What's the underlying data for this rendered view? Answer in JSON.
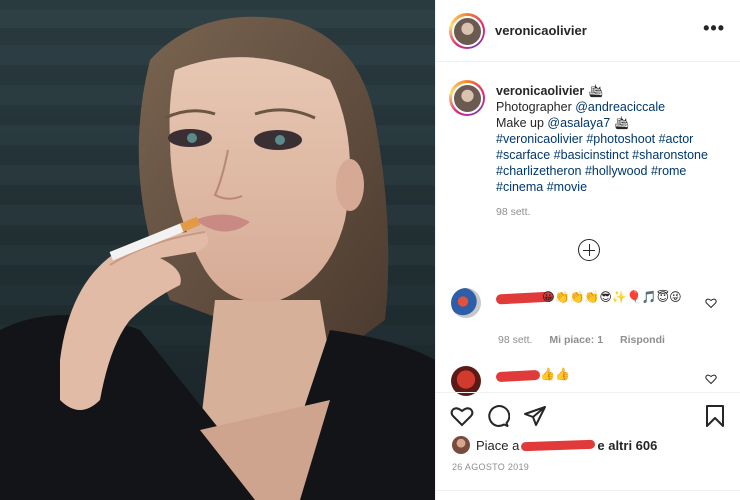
{
  "post": {
    "username": "veronicaolivier",
    "more_icon": "•••"
  },
  "caption": {
    "username": "veronicaolivier",
    "emoji1": "🛳",
    "line1": "Photographer ",
    "mention1": "@andreaciccale",
    "line2": "Make up ",
    "mention2": "@asalaya7",
    "emoji2": "🛳",
    "hashtags_line1": "#veronicaolivier #photoshoot #actor",
    "hashtags_line2": "#scarface #basicinstinct #sharonstone",
    "hashtags_line3": "#charlizetheron #hollywood #rome",
    "hashtags_line4": "#cinema #movie",
    "time": "98 sett."
  },
  "comments": [
    {
      "text": "😀👏👏👏😎✨🎈🎵😇😜",
      "time": "98 sett.",
      "likes": "Mi piace: 1",
      "reply": "Rispondi"
    },
    {
      "text": "👍👍"
    }
  ],
  "likes": {
    "prefix": "Piace a",
    "suffix": "e altri 606"
  },
  "date": "26 AGOSTO 2019",
  "colors": {
    "accent_link": "#00376b",
    "muted": "#8e8e8e",
    "redaction": "#e03a3a"
  }
}
